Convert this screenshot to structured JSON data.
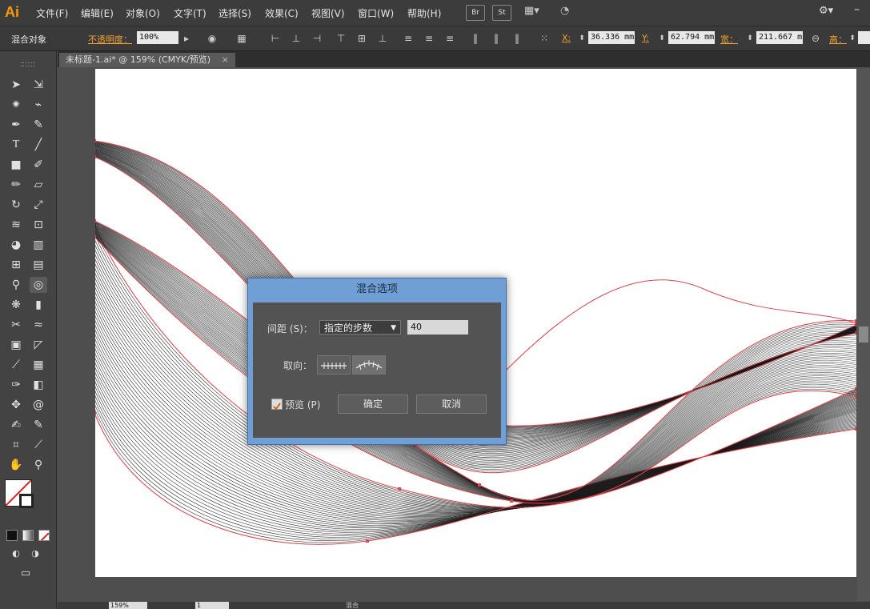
{
  "app": {
    "logo": "Ai"
  },
  "menu": [
    "文件(F)",
    "编辑(E)",
    "对象(O)",
    "文字(T)",
    "选择(S)",
    "效果(C)",
    "视图(V)",
    "窗口(W)",
    "帮助(H)"
  ],
  "menu_buttons": {
    "bridge": "Br",
    "stock": "St"
  },
  "control_bar": {
    "object_type": "混合对象",
    "opacity_label": "不透明度：",
    "opacity_value": "100%",
    "x_label": "X:",
    "x_value": "36.336 mm",
    "y_label": "Y:",
    "y_value": "62.794 mm",
    "w_label": "宽：",
    "w_value": "211.667 m",
    "h_label": "高："
  },
  "document_tab": {
    "title": "未标题-1.ai* @ 159% (CMYK/预览)",
    "close": "×"
  },
  "status_bar": {
    "zoom": "159%",
    "page": "1",
    "mode": "混合"
  },
  "dialog": {
    "title": "混合选项",
    "spacing_label": "间距 (S)：",
    "spacing_option": "指定的步数",
    "spacing_value": "40",
    "orientation_label": "取向：",
    "preview_label": "预览 (P)",
    "preview_checked": true,
    "ok_label": "确定",
    "cancel_label": "取消"
  },
  "colors": {
    "accent": "#ff9a00",
    "dialog_title_bg": "#6f9fd4",
    "path_highlight": "#e8424a"
  }
}
